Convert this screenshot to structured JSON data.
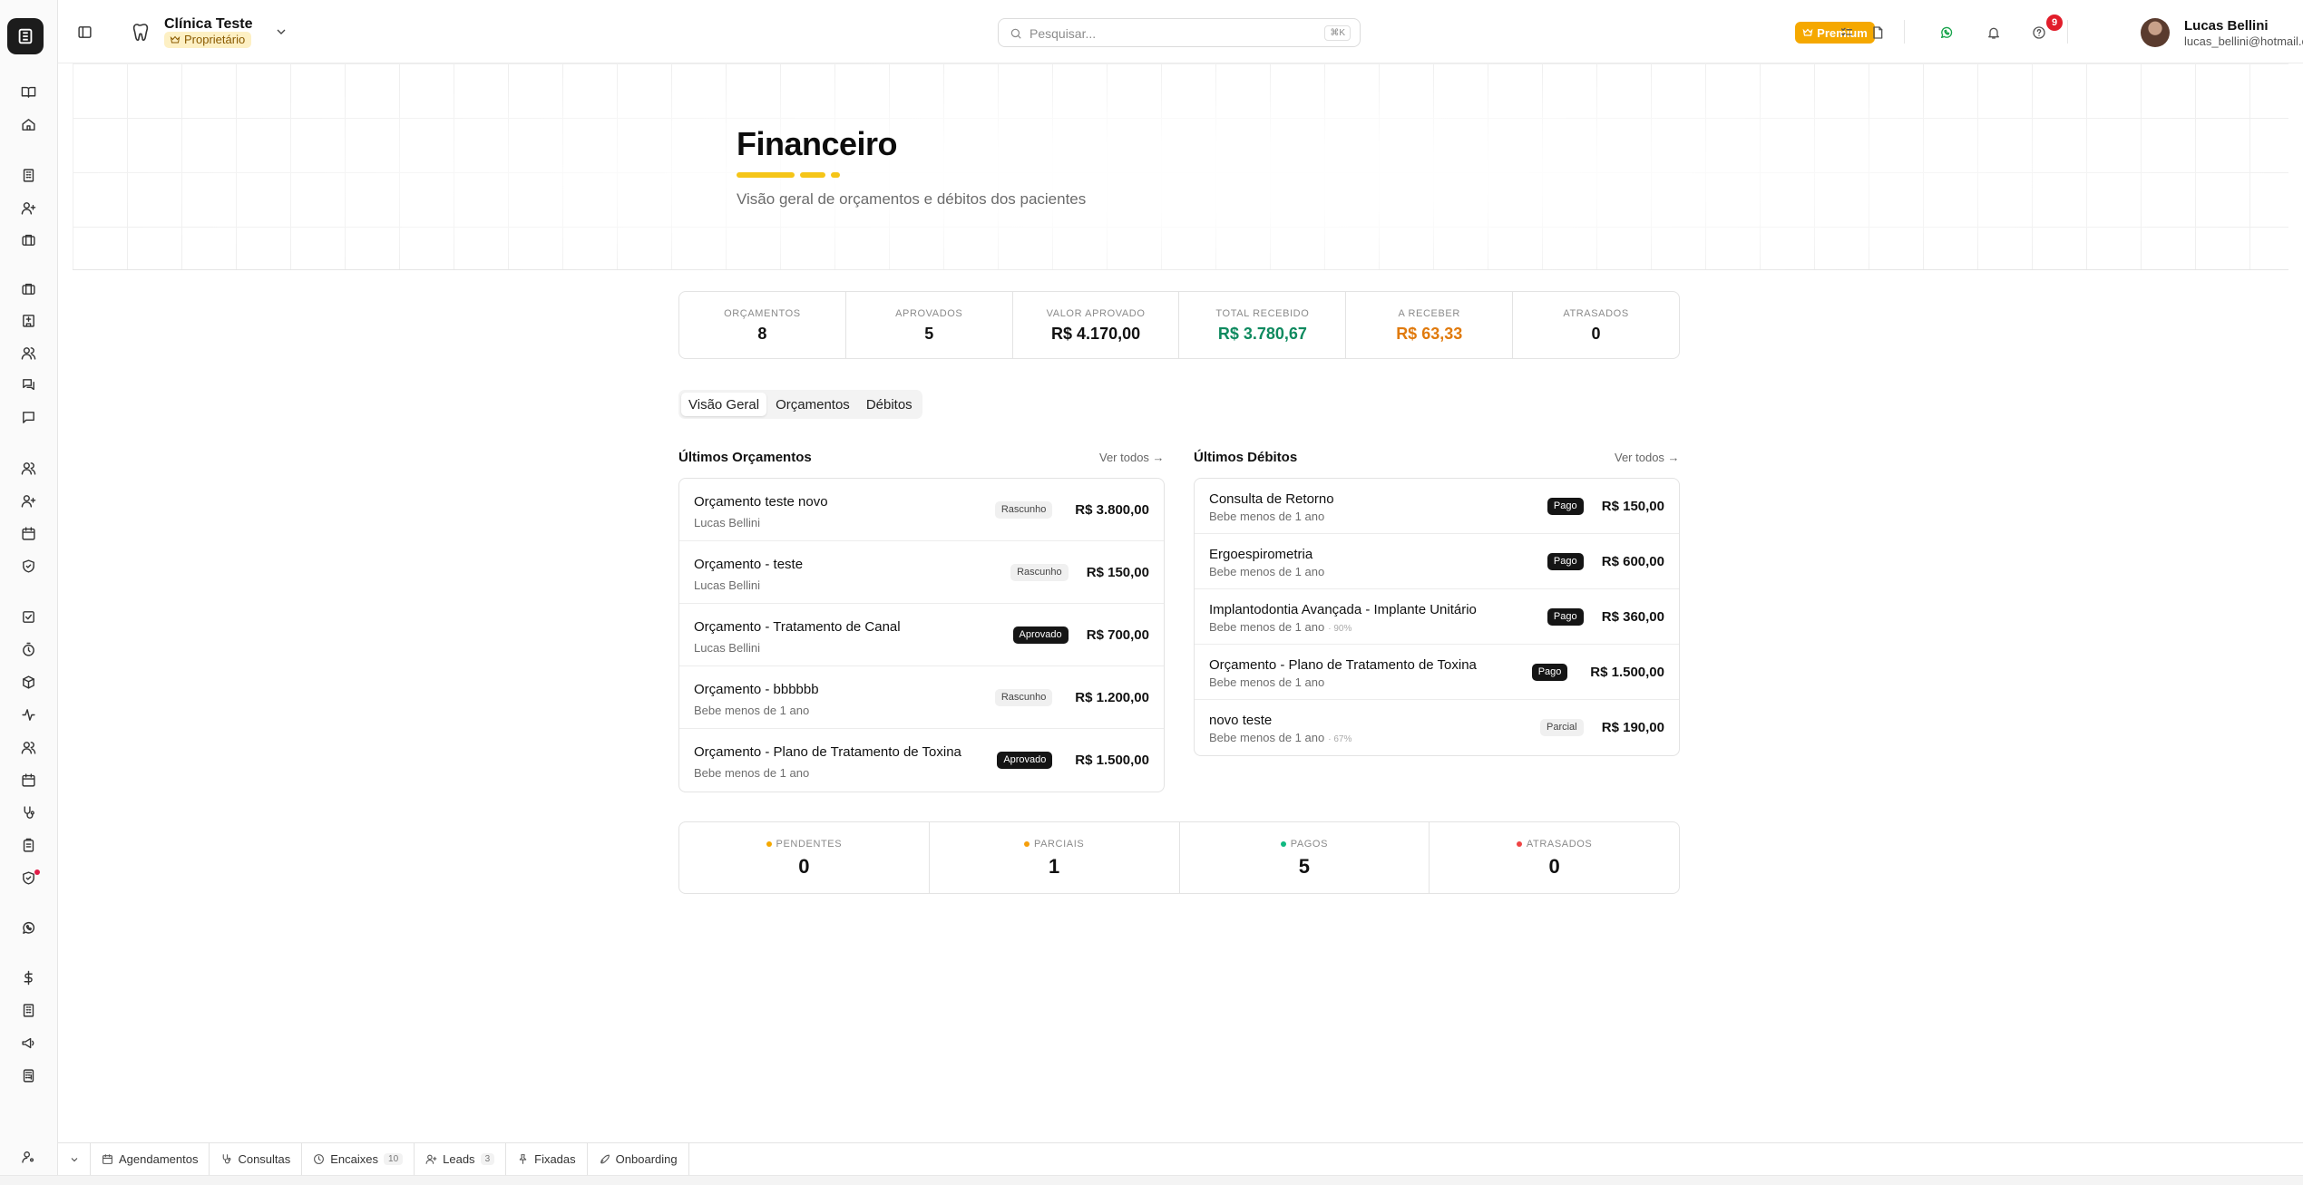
{
  "header": {
    "clinic_name": "Clínica Teste",
    "clinic_role": "Proprietário",
    "search_placeholder": "Pesquisar...",
    "search_shortcut": "⌘K",
    "premium_label": "Premium",
    "notification_count": "9",
    "user_name": "Lucas Bellini",
    "user_email": "lucas_bellini@hotmail.com.br"
  },
  "rail_icons": [
    "book-open-icon",
    "home-icon",
    "building-icon",
    "user-plus-icon",
    "briefcase-icon",
    "briefcase-icon",
    "hospital-icon",
    "users-icon",
    "messages-icon",
    "message-icon",
    "users-icon",
    "user-plus-icon",
    "calendar-icon",
    "shield-icon",
    "checkbox-icon",
    "timer-icon",
    "package-icon",
    "activity-icon",
    "users-icon",
    "calendar-icon",
    "stethoscope-icon",
    "clipboard-icon",
    "shield-check-icon",
    "whatsapp-icon",
    "dollar-icon",
    "building-icon",
    "megaphone-icon",
    "calculator-icon"
  ],
  "page": {
    "title": "Financeiro",
    "subtitle": "Visão geral de orçamentos e débitos dos pacientes"
  },
  "stats": [
    {
      "label": "ORÇAMENTOS",
      "value": "8",
      "tone": "default"
    },
    {
      "label": "APROVADOS",
      "value": "5",
      "tone": "default"
    },
    {
      "label": "VALOR APROVADO",
      "value": "R$ 4.170,00",
      "tone": "default"
    },
    {
      "label": "TOTAL RECEBIDO",
      "value": "R$ 3.780,67",
      "tone": "green"
    },
    {
      "label": "A RECEBER",
      "value": "R$ 63,33",
      "tone": "orange"
    },
    {
      "label": "ATRASADOS",
      "value": "0",
      "tone": "default"
    }
  ],
  "tabs": [
    {
      "label": "Visão Geral",
      "active": true
    },
    {
      "label": "Orçamentos",
      "active": false
    },
    {
      "label": "Débitos",
      "active": false
    }
  ],
  "orcamentos": {
    "title": "Últimos Orçamentos",
    "see_all": "Ver todos →",
    "items": [
      {
        "title": "Orçamento teste novo",
        "sub": "Lucas Bellini",
        "status": "Rascunho",
        "kind": "draft",
        "amount": "R$ 3.800,00"
      },
      {
        "title": "Orçamento - teste",
        "sub": "Lucas Bellini",
        "status": "Rascunho",
        "kind": "draft",
        "amount": "R$ 150,00"
      },
      {
        "title": "Orçamento - Tratamento de Canal",
        "sub": "Lucas Bellini",
        "status": "Aprovado",
        "kind": "dark",
        "amount": "R$ 700,00"
      },
      {
        "title": "Orçamento - bbbbbb",
        "sub": "Bebe menos de 1 ano",
        "status": "Rascunho",
        "kind": "draft",
        "amount": "R$ 1.200,00"
      },
      {
        "title": "Orçamento - Plano de Tratamento de Toxina",
        "sub": "Bebe menos de 1 ano",
        "status": "Aprovado",
        "kind": "dark",
        "amount": "R$ 1.500,00"
      }
    ]
  },
  "debitos": {
    "title": "Últimos Débitos",
    "see_all": "Ver todos →",
    "items": [
      {
        "title": "Consulta de Retorno",
        "sub": "Bebe menos de 1 ano",
        "pct": "",
        "status": "Pago",
        "kind": "dark",
        "amount": "R$ 150,00"
      },
      {
        "title": "Ergoespirometria",
        "sub": "Bebe menos de 1 ano",
        "pct": "",
        "status": "Pago",
        "kind": "dark",
        "amount": "R$ 600,00"
      },
      {
        "title": "Implantodontia Avançada - Implante Unitário",
        "sub": "Bebe menos de 1 ano",
        "pct": "· 90%",
        "status": "Pago",
        "kind": "dark",
        "amount": "R$ 360,00"
      },
      {
        "title": "Orçamento - Plano de Tratamento de Toxina",
        "sub": "Bebe menos de 1 ano",
        "pct": "",
        "status": "Pago",
        "kind": "dark",
        "amount": "R$ 1.500,00"
      },
      {
        "title": "novo teste",
        "sub": "Bebe menos de 1 ano",
        "pct": "· 67%",
        "status": "Parcial",
        "kind": "draft",
        "amount": "R$ 190,00"
      }
    ]
  },
  "summary": [
    {
      "label": "PENDENTES",
      "value": "0",
      "dot_color": "#f5a800"
    },
    {
      "label": "PARCIAIS",
      "value": "1",
      "dot_color": "#f59e0b"
    },
    {
      "label": "PAGOS",
      "value": "5",
      "dot_color": "#10b981"
    },
    {
      "label": "ATRASADOS",
      "value": "0",
      "dot_color": "#ef4444"
    }
  ],
  "bottombar": [
    {
      "label": "Agendamentos",
      "icon": "calendar-icon",
      "count": ""
    },
    {
      "label": "Consultas",
      "icon": "stethoscope-icon",
      "count": ""
    },
    {
      "label": "Encaixes",
      "icon": "clock-icon",
      "count": "10"
    },
    {
      "label": "Leads",
      "icon": "user-plus-icon",
      "count": "3"
    },
    {
      "label": "Fixadas",
      "icon": "pin-icon",
      "count": ""
    },
    {
      "label": "Onboarding",
      "icon": "rocket-icon",
      "count": ""
    }
  ],
  "colors": {
    "accent_yellow": "#f5c518",
    "premium": "#f5a800",
    "green": "#0f8a5f",
    "orange": "#e07a0d",
    "badge_red": "#e11d2a"
  }
}
